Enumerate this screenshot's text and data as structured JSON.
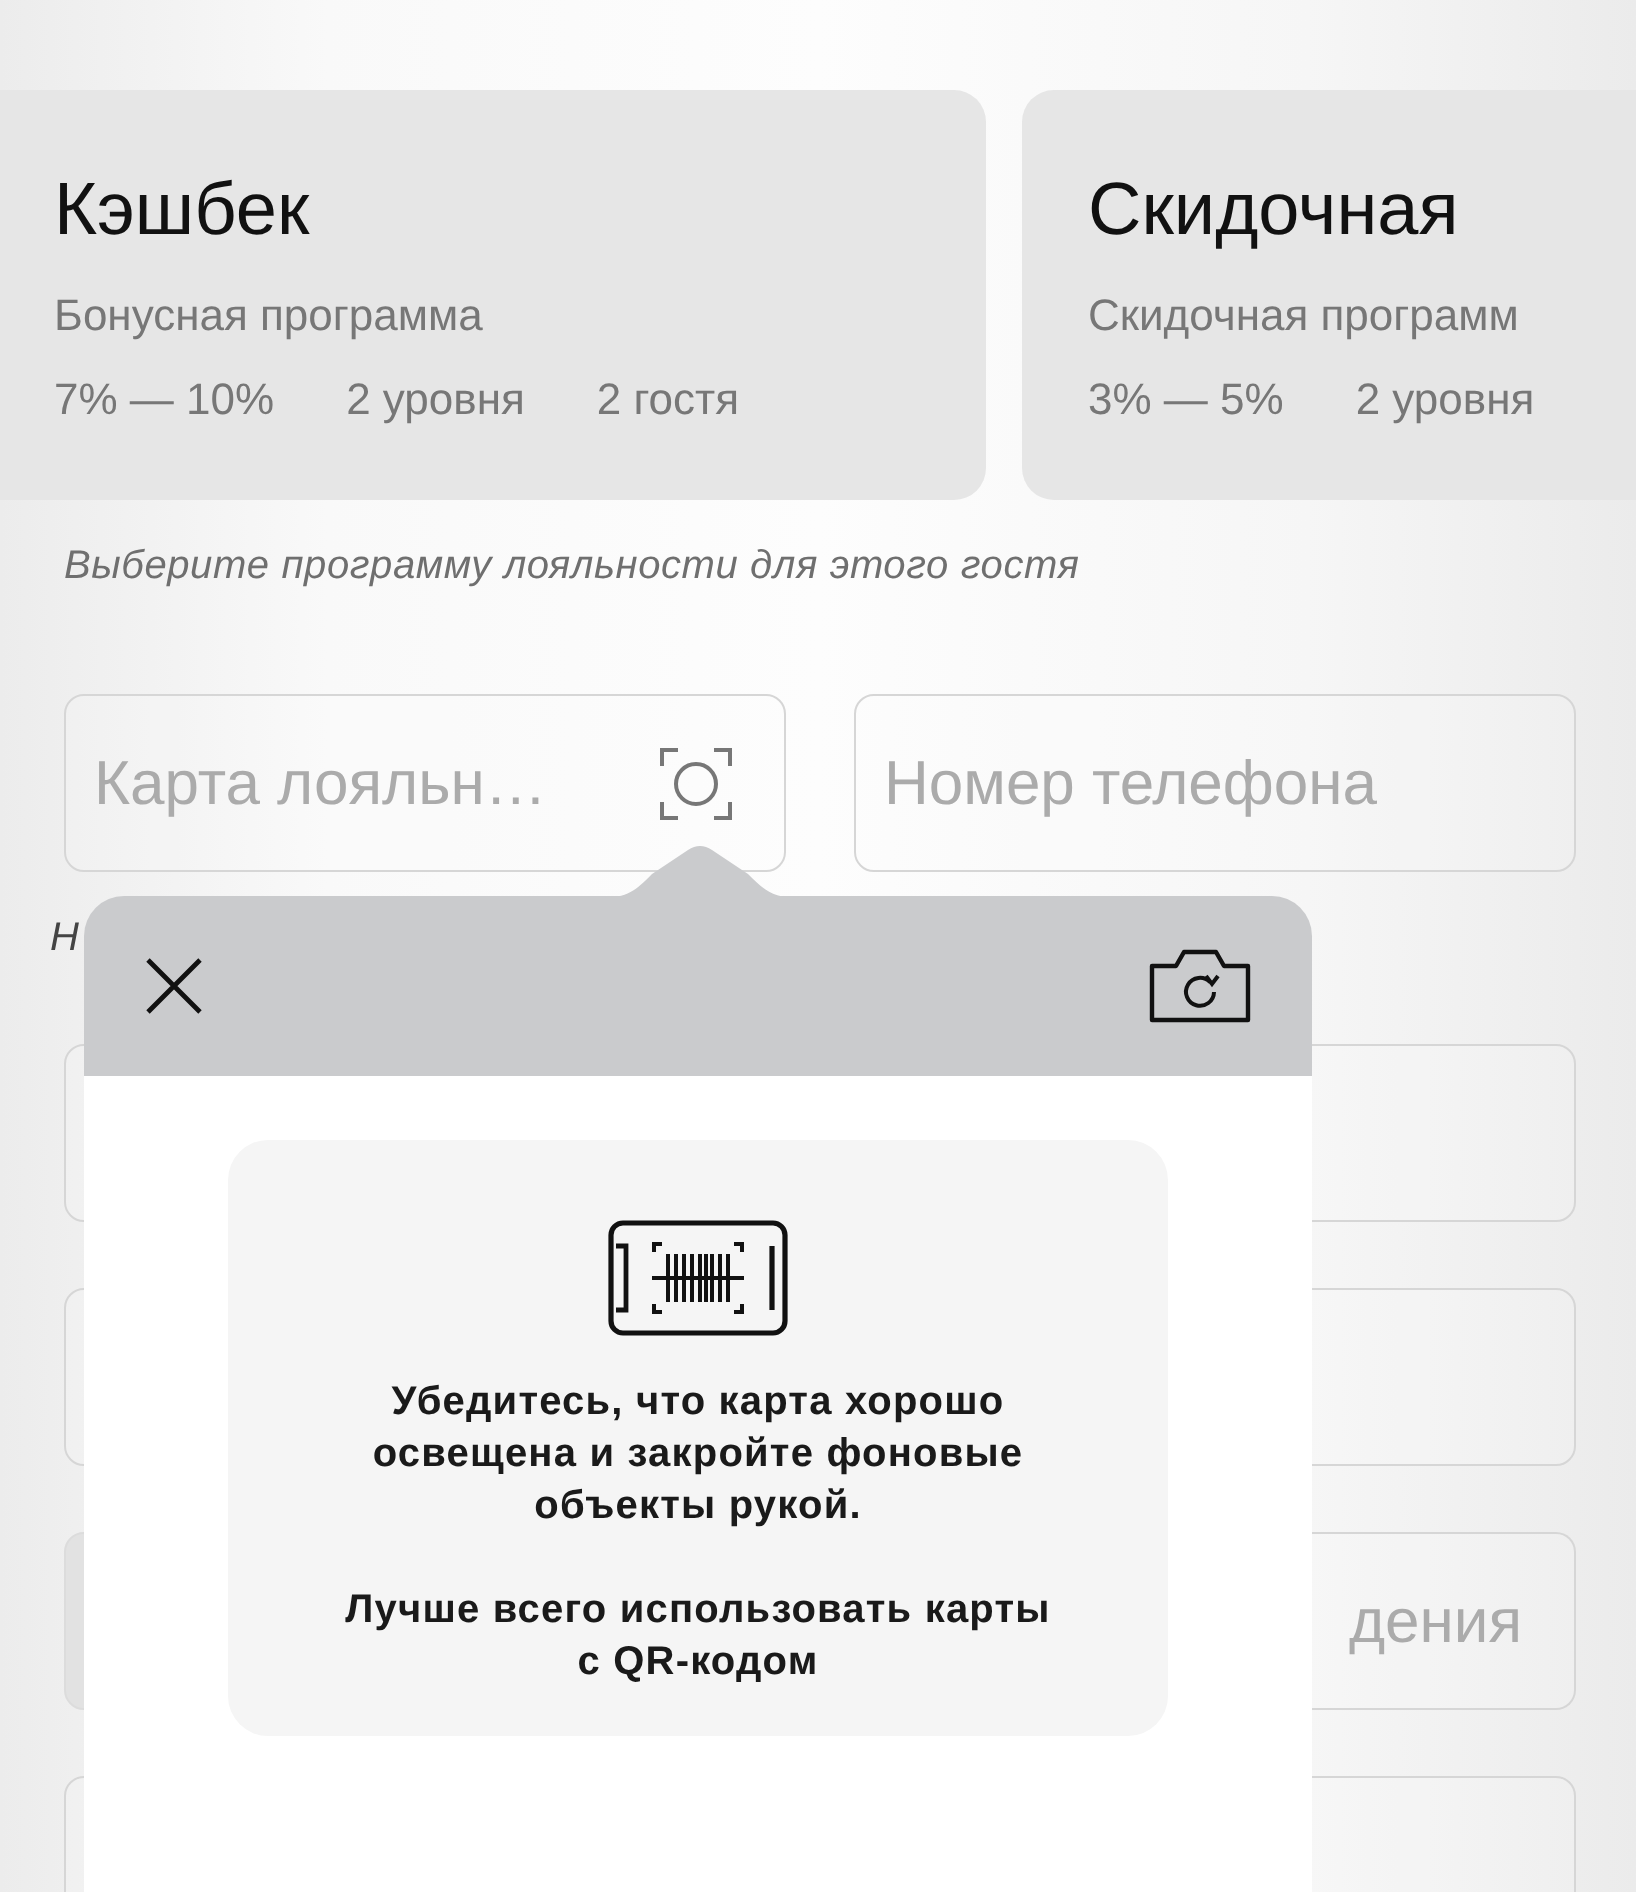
{
  "programs": [
    {
      "title": "Кэшбек",
      "subtitle": "Бонусная программа",
      "stats": [
        "7% — 10%",
        "2 уровня",
        "2 гостя"
      ]
    },
    {
      "title": "Скидочная",
      "subtitle": "Скидочная программ",
      "stats": [
        "3% — 5%",
        "2 уровня"
      ]
    }
  ],
  "hint": "Выберите программу лояльности для этого гостя",
  "fields": [
    {
      "kind": "scan",
      "placeholder": "Карта лояльн…"
    },
    {
      "kind": "plain",
      "placeholder": "Номер телефона"
    }
  ],
  "note": "Н",
  "form_rows": [
    {
      "kind": "full"
    },
    {
      "kind": "full"
    },
    {
      "kind": "split",
      "placeholder": "дения"
    },
    {
      "kind": "full"
    }
  ],
  "scanner": {
    "tips": [
      "Убедитесь, что карта хорошо освещена и закройте фоновые объекты рукой.",
      "Лучше всего использовать карты с QR-кодом"
    ]
  }
}
